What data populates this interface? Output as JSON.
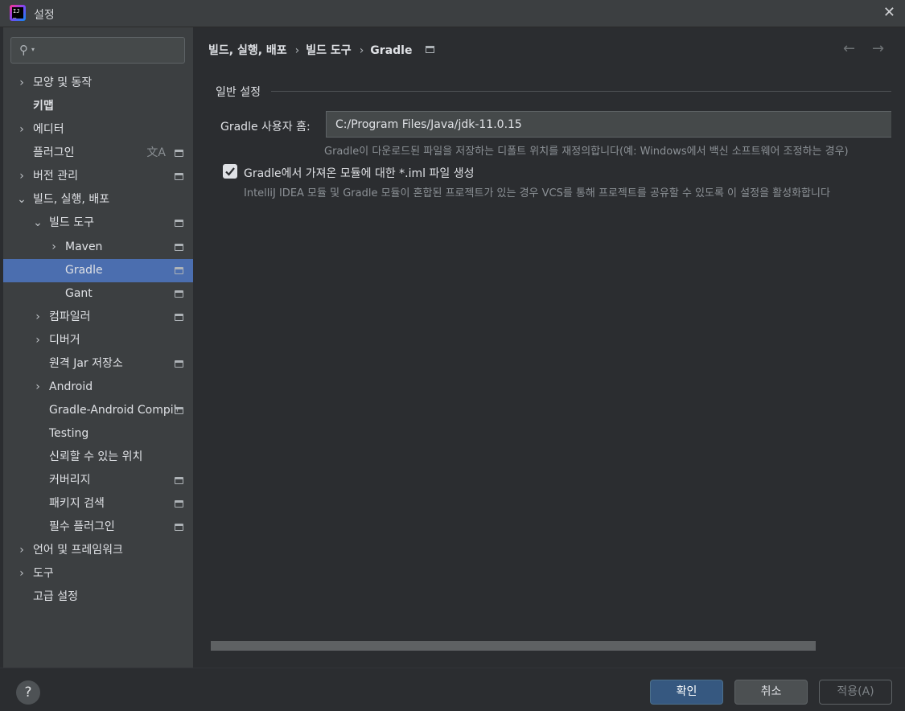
{
  "window": {
    "title": "설정"
  },
  "search": {
    "placeholder": ""
  },
  "sidebar": {
    "items": [
      {
        "label": "모양 및 동작"
      },
      {
        "label": "키맵"
      },
      {
        "label": "에디터"
      },
      {
        "label": "플러그인"
      },
      {
        "label": "버전 관리"
      },
      {
        "label": "빌드, 실행, 배포"
      },
      {
        "label": "빌드 도구"
      },
      {
        "label": "Maven"
      },
      {
        "label": "Gradle"
      },
      {
        "label": "Gant"
      },
      {
        "label": "컴파일러"
      },
      {
        "label": "디버거"
      },
      {
        "label": "원격 Jar 저장소"
      },
      {
        "label": "Android"
      },
      {
        "label": "Gradle-Android Compiler"
      },
      {
        "label": "Testing"
      },
      {
        "label": "신뢰할 수 있는 위치"
      },
      {
        "label": "커버리지"
      },
      {
        "label": "패키지 검색"
      },
      {
        "label": "필수 플러그인"
      },
      {
        "label": "언어 및 프레임워크"
      },
      {
        "label": "도구"
      },
      {
        "label": "고급 설정"
      }
    ]
  },
  "breadcrumb": {
    "items": [
      "빌드, 실행, 배포",
      "빌드 도구",
      "Gradle"
    ],
    "separator": "›"
  },
  "main": {
    "section_title": "일반 설정",
    "user_home_label": "Gradle 사용자 홈:",
    "user_home_value": "C:/Program Files/Java/jdk-11.0.15",
    "user_home_hint": "Gradle이 다운로드된 파일을 저장하는 디폴트 위치를 재정의합니다(예: Windows에서 백신 소프트웨어 조정하는 경우)",
    "iml_checkbox_label": "Gradle에서 가져온 모듈에 대한 *.iml 파일 생성",
    "iml_checked": true,
    "iml_hint": "IntelliJ IDEA 모듈 및 Gradle 모듈이 혼합된 프로젝트가 있는 경우 VCS를 통해 프로젝트를 공유할 수 있도록 이 설정을 활성화합니다"
  },
  "buttons": {
    "help": "?",
    "ok": "확인",
    "cancel": "취소",
    "apply": "적용(A)"
  },
  "icons": {
    "back": "←",
    "forward": "→",
    "close": "✕",
    "expand": "›",
    "collapse": "⌄",
    "translate": "文A"
  },
  "colors": {
    "selection": "#4b6eaf",
    "ok_button": "#365880"
  }
}
